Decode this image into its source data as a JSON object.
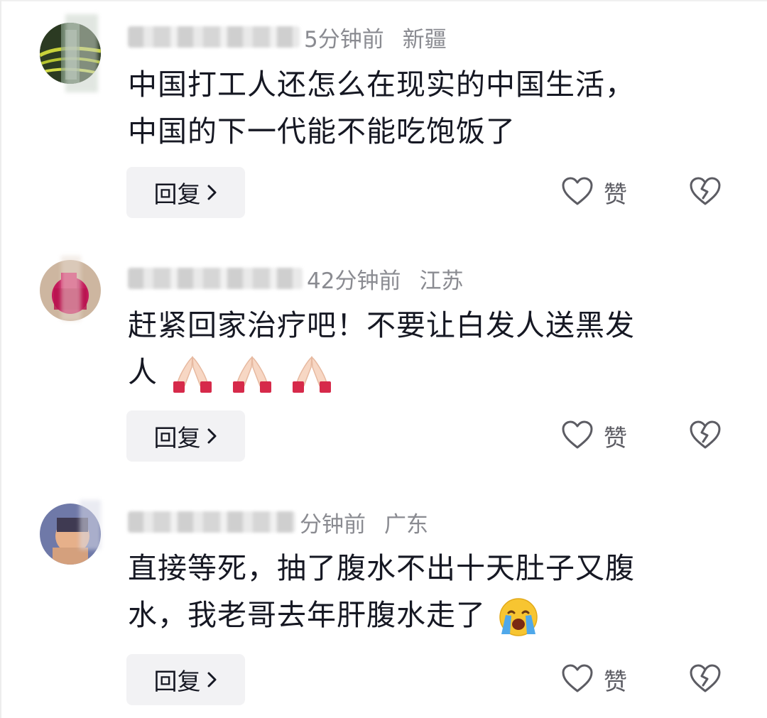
{
  "comments": [
    {
      "time": "5分钟前",
      "region": "新疆",
      "lines": [
        "中国打工人还怎么在现实的中国生活，",
        "中国的下一代能不能吃饱饭了"
      ],
      "reply_label": "回复",
      "like_label": "赞"
    },
    {
      "time": "42分钟前",
      "region": "江苏",
      "lines": [
        "赶紧回家治疗吧！不要让白发人送黑发",
        "人"
      ],
      "line2_emojis": [
        "folded-hands",
        "folded-hands",
        "folded-hands"
      ],
      "reply_label": "回复",
      "like_label": "赞"
    },
    {
      "time": "分钟前",
      "region": "广东",
      "lines": [
        "直接等死，抽了腹水不出十天肚子又腹",
        "水，我老哥去年肝腹水走了"
      ],
      "line2_emojis": [
        "loudly-crying-face"
      ],
      "reply_label": "回复",
      "like_label": "赞"
    }
  ],
  "colors": {
    "text": "#161823",
    "meta": "#8a8b91",
    "button_bg": "#f2f2f4",
    "icon": "#5c5c63"
  }
}
